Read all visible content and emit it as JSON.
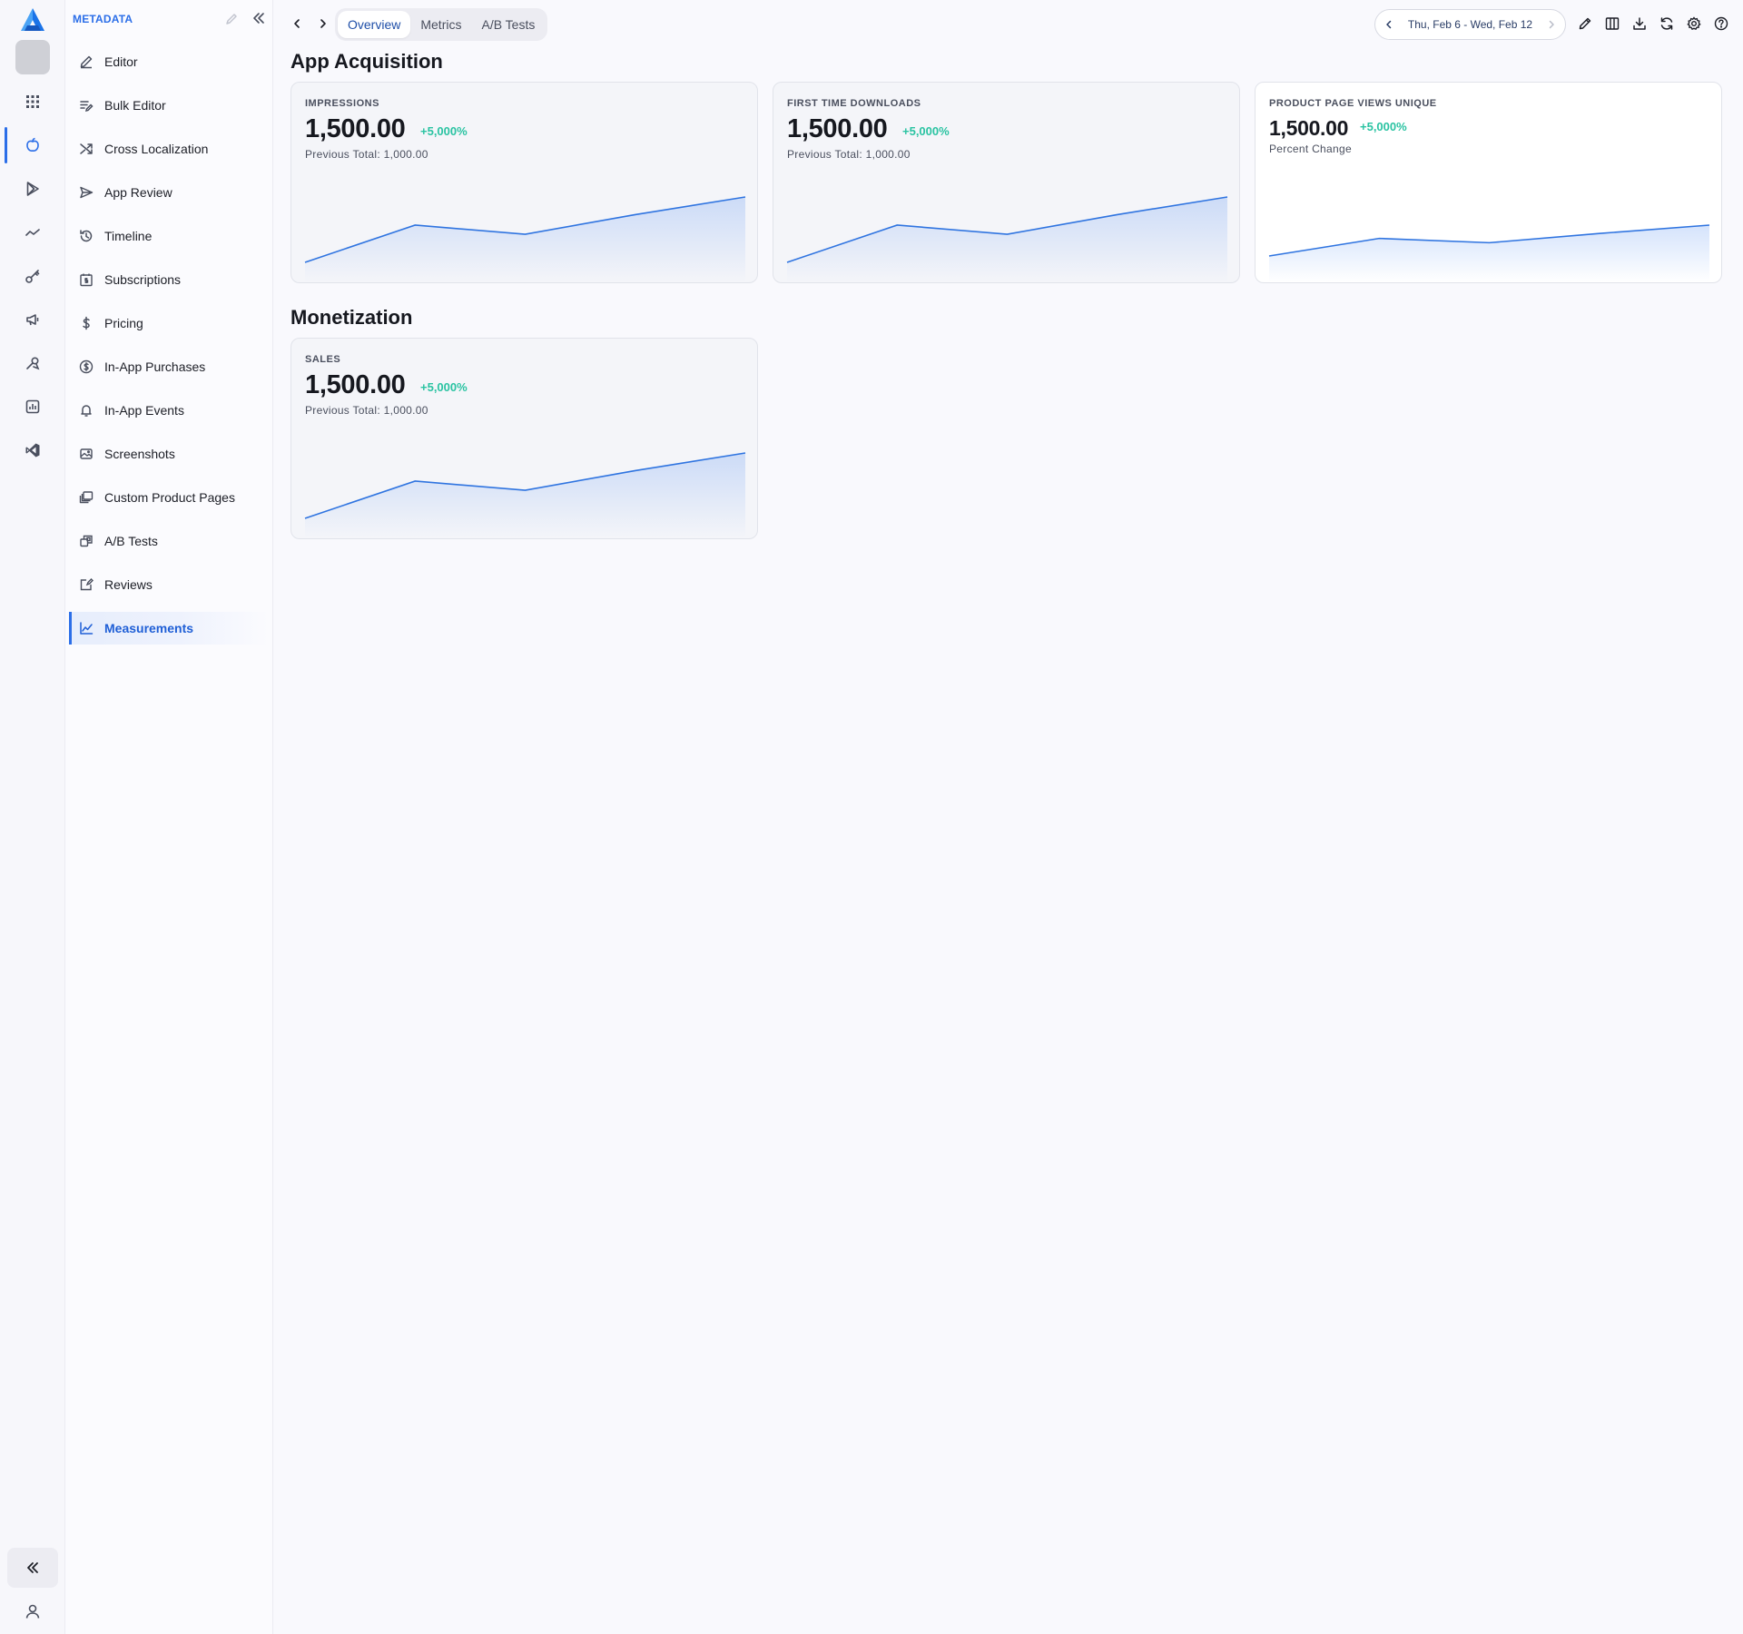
{
  "rail": {
    "items": [
      {
        "name": "apps-grid-icon",
        "active": false
      },
      {
        "name": "apple-icon",
        "active": true
      },
      {
        "name": "google-play-icon",
        "active": false
      },
      {
        "name": "trend-icon",
        "active": false
      },
      {
        "name": "key-icon",
        "active": false
      },
      {
        "name": "megaphone-icon",
        "active": false
      },
      {
        "name": "tools-icon",
        "active": false
      },
      {
        "name": "analytics-icon",
        "active": false
      },
      {
        "name": "vscode-icon",
        "active": false
      }
    ]
  },
  "sidebar": {
    "title": "METADATA",
    "items": [
      {
        "label": "Editor",
        "icon": "pencil-icon"
      },
      {
        "label": "Bulk Editor",
        "icon": "bulk-edit-icon"
      },
      {
        "label": "Cross Localization",
        "icon": "shuffle-icon"
      },
      {
        "label": "App Review",
        "icon": "send-icon"
      },
      {
        "label": "Timeline",
        "icon": "history-icon"
      },
      {
        "label": "Subscriptions",
        "icon": "subscription-icon"
      },
      {
        "label": "Pricing",
        "icon": "dollar-icon"
      },
      {
        "label": "In-App Purchases",
        "icon": "dollar-circle-icon"
      },
      {
        "label": "In-App Events",
        "icon": "bell-icon"
      },
      {
        "label": "Screenshots",
        "icon": "image-icon"
      },
      {
        "label": "Custom Product Pages",
        "icon": "pages-icon"
      },
      {
        "label": "A/B Tests",
        "icon": "ab-test-icon"
      },
      {
        "label": "Reviews",
        "icon": "review-icon"
      },
      {
        "label": "Measurements",
        "icon": "chart-line-icon",
        "active": true
      }
    ]
  },
  "topbar": {
    "tabs": [
      {
        "label": "Overview",
        "active": true
      },
      {
        "label": "Metrics",
        "active": false
      },
      {
        "label": "A/B Tests",
        "active": false
      }
    ],
    "date_range": "Thu, Feb 6 - Wed, Feb 12",
    "tools": [
      "pencil-icon",
      "columns-icon",
      "download-icon",
      "refresh-icon",
      "settings-icon",
      "help-icon"
    ]
  },
  "sections": {
    "acquisition": {
      "title": "App Acquisition",
      "cards": [
        {
          "label": "IMPRESSIONS",
          "value": "1,500.00",
          "change": "+5,000%",
          "sub": "Previous Total: 1,000.00"
        },
        {
          "label": "FIRST TIME DOWNLOADS",
          "value": "1,500.00",
          "change": "+5,000%",
          "sub": "Previous Total: 1,000.00"
        },
        {
          "label": "PRODUCT PAGE VIEWS UNIQUE",
          "value": "1,500.00",
          "change": "+5,000%",
          "sub": "Percent Change"
        }
      ]
    },
    "monetization": {
      "title": "Monetization",
      "cards": [
        {
          "label": "SALES",
          "value": "1,500.00",
          "change": "+5,000%",
          "sub": "Previous Total: 1,000.00"
        }
      ]
    }
  },
  "chart_data": [
    {
      "type": "area",
      "title": "",
      "series": [
        {
          "values": [
            0,
            0.57,
            0.43,
            0.73,
            1
          ]
        }
      ]
    },
    {
      "type": "area",
      "title": "",
      "series": [
        {
          "values": [
            0,
            0.57,
            0.43,
            0.73,
            1
          ]
        }
      ]
    },
    {
      "type": "area",
      "title": "",
      "series": [
        {
          "values": [
            0,
            0.57,
            0.43,
            0.73,
            1
          ]
        }
      ]
    },
    {
      "type": "area",
      "title": "",
      "series": [
        {
          "values": [
            0,
            0.57,
            0.43,
            0.73,
            1
          ]
        }
      ]
    }
  ],
  "colors": {
    "accent": "#2b6ee8",
    "positive": "#2ac3a2",
    "line": "#2f74e0"
  }
}
